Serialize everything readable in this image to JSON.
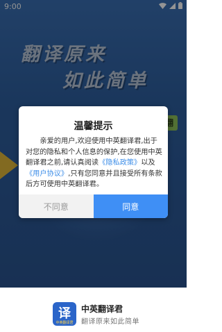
{
  "status_bar": {
    "time": "9:00"
  },
  "background": {
    "slogan_line1": "翻译原来",
    "slogan_line2": "如此简单",
    "sticker_right": "翻"
  },
  "dialog": {
    "title": "温馨提示",
    "text_before": "亲爱的用户,欢迎使用中英翻译君,出于对您的隐私和个人信息的保护,在您使用中英翻译君之前,请认真阅读",
    "privacy_link": "《隐私政策》",
    "text_and": "以及",
    "agreement_link": "《用户协议》",
    "text_after": ",只有您同意并且接受所有条款后方可使用中英翻译君。",
    "disagree_label": "不同意",
    "agree_label": "同意"
  },
  "footer": {
    "logo_glyph": "译",
    "logo_caption": "中英翻译君",
    "app_name": "中英翻译君",
    "tagline": "翻译原来如此简单"
  },
  "colors": {
    "accent": "#3f8ff5",
    "link": "#3e8ee8",
    "background": "#2e5f9f"
  }
}
